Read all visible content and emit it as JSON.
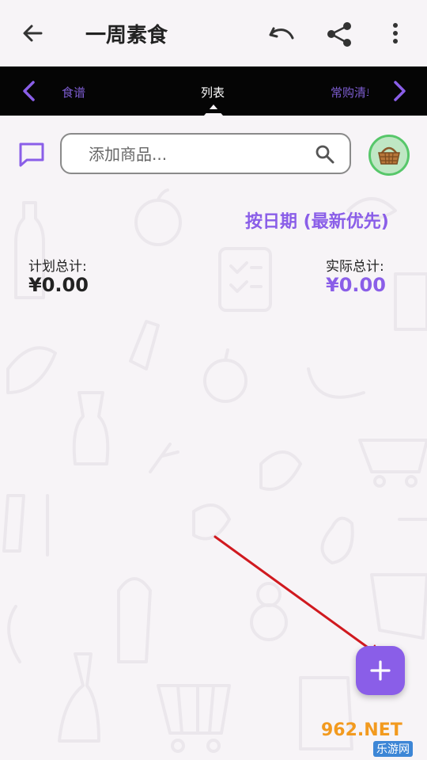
{
  "header": {
    "title": "一周素食",
    "back_icon": "arrow-left-icon",
    "undo_icon": "undo-icon",
    "share_icon": "share-icon",
    "more_icon": "more-vertical-icon"
  },
  "tabs": {
    "left": "食谱",
    "center": "列表",
    "right": "常购清单"
  },
  "search": {
    "placeholder": "添加商品..."
  },
  "sort": {
    "label": "按日期 (最新优先)"
  },
  "totals": {
    "planned_label": "计划总计:",
    "planned_value": "¥0.00",
    "actual_label": "实际总计:",
    "actual_value": "¥0.00"
  },
  "colors": {
    "accent": "#8a5ee8",
    "tabbar_bg": "#050505",
    "page_bg": "#f7f4f7",
    "basket_bg": "#bfe7c4",
    "basket_border": "#57c76a",
    "annotation_arrow": "#d0191f"
  },
  "watermark": {
    "top": "962.NET",
    "bottom": "乐游网"
  }
}
